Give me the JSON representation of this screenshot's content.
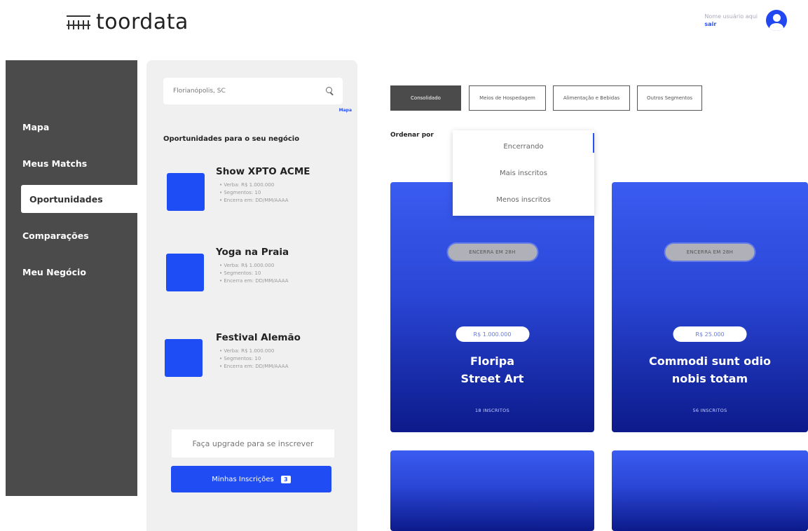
{
  "header": {
    "logo_text": "toordata",
    "user_name": "Nome usuário aqui",
    "exit_label": "sair"
  },
  "sidebar": {
    "items": [
      {
        "label": "Mapa"
      },
      {
        "label": "Meus Matchs"
      },
      {
        "label": "Oportunidades",
        "active": true
      },
      {
        "label": "Comparações"
      },
      {
        "label": "Meu Negócio"
      }
    ]
  },
  "panel": {
    "search_value": "Florianópolis, SC",
    "brand_link": "Mapa",
    "title": "Oportunidades para o seu negócio",
    "opportunities": [
      {
        "title": "Show XPTO ACME",
        "details": [
          "• Verba: R$ 1.000.000",
          "• Segmentos: 10",
          "• Encerra em: DD/MM/AAAA"
        ]
      },
      {
        "title": "Yoga na Praia",
        "details": [
          "• Verba: R$ 1.000.000",
          "• Segmentos: 10",
          "• Encerra em: DD/MM/AAAA"
        ]
      },
      {
        "title": "Festival Alemão",
        "details": [
          "• Verba: R$ 1.000.000",
          "• Segmentos: 10",
          "• Encerra em: DD/MM/AAAA"
        ]
      }
    ],
    "upgrade_label": "Faça upgrade para se inscrever",
    "my_subs_label": "Minhas Inscrições",
    "my_subs_count": "3"
  },
  "tabs": [
    {
      "label": "Consolidado",
      "active": true
    },
    {
      "label": "Meios de Hospedagem"
    },
    {
      "label": "Alimentação e Bebidas"
    },
    {
      "label": "Outros Segmentos"
    }
  ],
  "sort": {
    "label": "Ordenar por",
    "options": [
      "Encerrando",
      "Mais inscritos",
      "Menos inscritos"
    ]
  },
  "cards": [
    {
      "ends": "ENCERRA EM 28H",
      "price": "R$ 1.000.000",
      "title_line1": "Floripa",
      "title_line2": "Street Art",
      "subs": "18 INSCRITOS"
    },
    {
      "ends": "ENCERRA EM 28H",
      "price": "R$ 25.000",
      "title_line1": "Commodi sunt odio",
      "title_line2": "nobis totam",
      "subs": "56 INSCRITOS"
    }
  ],
  "colors": {
    "accent": "#1f4cf3",
    "sidebar_bg": "#4b4b4b",
    "panel_bg": "#f0f0f0"
  }
}
